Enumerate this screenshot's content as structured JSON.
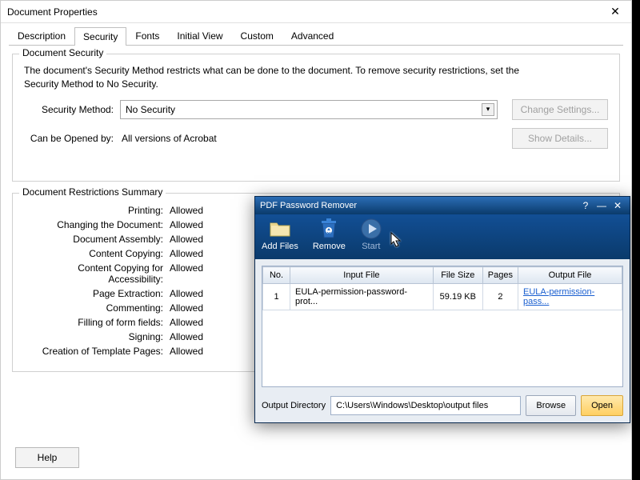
{
  "dp": {
    "title": "Document Properties",
    "tabs": [
      "Description",
      "Security",
      "Fonts",
      "Initial View",
      "Custom",
      "Advanced"
    ],
    "active_tab_index": 1,
    "security_group": "Document Security",
    "desc": "The document's Security Method restricts what can be done to the document. To remove security restrictions, set the Security Method to No Security.",
    "sm_label": "Security Method:",
    "sm_value": "No Security",
    "change_settings": "Change Settings...",
    "opened_label": "Can be Opened by:",
    "opened_value": "All versions of Acrobat",
    "show_details": "Show Details...",
    "drs_title": "Document Restrictions Summary",
    "restrictions": [
      {
        "label": "Printing:",
        "value": "Allowed"
      },
      {
        "label": "Changing the Document:",
        "value": "Allowed"
      },
      {
        "label": "Document Assembly:",
        "value": "Allowed"
      },
      {
        "label": "Content Copying:",
        "value": "Allowed"
      },
      {
        "label": "Content Copying for Accessibility:",
        "value": "Allowed"
      },
      {
        "label": "Page Extraction:",
        "value": "Allowed"
      },
      {
        "label": "Commenting:",
        "value": "Allowed"
      },
      {
        "label": "Filling of form fields:",
        "value": "Allowed"
      },
      {
        "label": "Signing:",
        "value": "Allowed"
      },
      {
        "label": "Creation of Template Pages:",
        "value": "Allowed"
      }
    ],
    "help": "Help"
  },
  "ppr": {
    "title": "PDF Password Remover",
    "tools": {
      "add": "Add Files",
      "remove": "Remove",
      "start": "Start"
    },
    "columns": [
      "No.",
      "Input File",
      "File Size",
      "Pages",
      "Output File"
    ],
    "rows": [
      {
        "no": "1",
        "input": "EULA-permission-password-prot...",
        "size": "59.19 KB",
        "pages": "2",
        "output": "EULA-permission-pass..."
      }
    ],
    "outdir_label": "Output Directory",
    "outdir_value": "C:\\Users\\Windows\\Desktop\\output files",
    "browse": "Browse",
    "open": "Open"
  }
}
